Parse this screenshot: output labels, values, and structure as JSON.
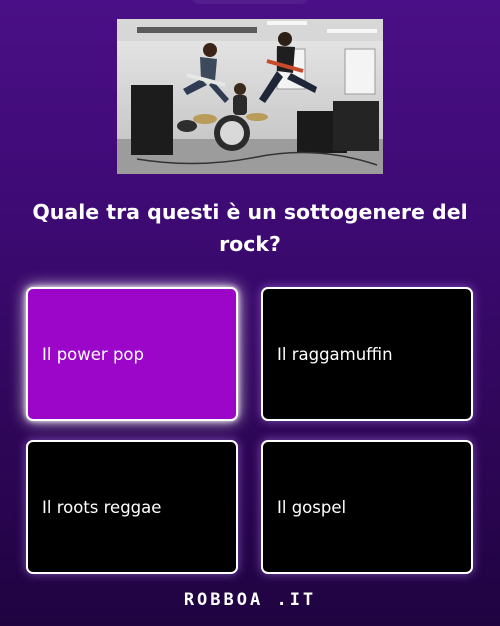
{
  "question": "Quale tra questi è un sottogenere del rock?",
  "answers": [
    {
      "label": "Il power pop",
      "selected": true
    },
    {
      "label": "Il raggamuffin",
      "selected": false
    },
    {
      "label": "Il roots reggae",
      "selected": false
    },
    {
      "label": "Il gospel",
      "selected": false
    }
  ],
  "brand": "ROBBOA .IT",
  "colors": {
    "background_top": "#4a0f86",
    "background_bottom": "#1f0340",
    "selected_answer": "#9b06c9",
    "answer": "#000000"
  }
}
